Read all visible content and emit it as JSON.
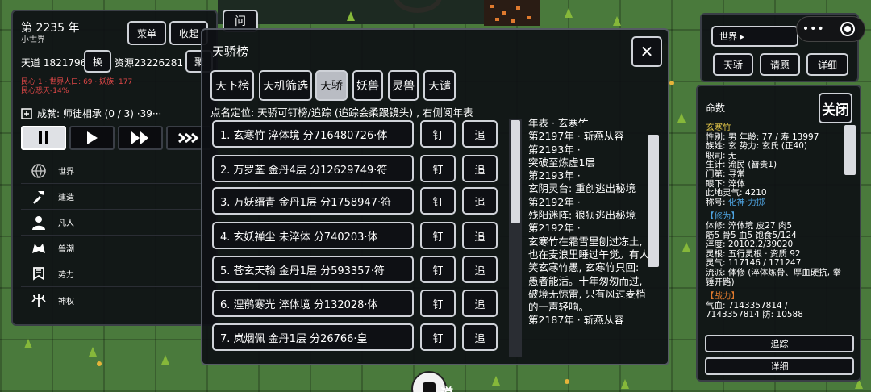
{
  "left": {
    "year": "第 2235 年",
    "world_name": "小世界",
    "menu": "菜单",
    "collapse": "收起",
    "tiandao": "天道 1821796",
    "swap": "换",
    "resource": "资源23226281",
    "extra": "聚",
    "line1": "民心 1 · 世界人口: 69 · 妖族: 177",
    "line2": "民心恐天-14%",
    "achievement": "成就: 师徒相承 (0 / 3) ·39···",
    "nav": [
      {
        "label": "世界",
        "icon": "globe-icon"
      },
      {
        "label": "建造",
        "icon": "hammer-icon"
      },
      {
        "label": "凡人",
        "icon": "person-icon"
      },
      {
        "label": "兽潮",
        "icon": "wolf-icon"
      },
      {
        "label": "势力",
        "icon": "banner-icon"
      },
      {
        "label": "神权",
        "icon": "trident-icon"
      }
    ]
  },
  "top_center_button": "问",
  "dialog": {
    "title": "天骄榜",
    "close": "✕",
    "tabs": [
      "天下榜",
      "天机筛选",
      "天骄",
      "妖兽",
      "灵兽",
      "天谴"
    ],
    "active_tab": 2,
    "hint": "点名定位: 天骄可钉榜/追踪 (追踪会柔跟镜头) , 右侧阅年表",
    "pin": "钉",
    "track": "追",
    "rows": [
      "1. 玄寒竹  淬体境  分716480726·体",
      "2. 万罗荃  金丹4层  分12629749·符",
      "3. 万妖缙青  金丹1层  分1758947·符",
      "4. 玄妖禅尘  未淬体  分740203·体",
      "5. 苍玄天翰  金丹1层  分593357·符",
      "6. 浬鹡寒光  淬体境  分132028·体",
      "7. 岚烟佩  金丹1层  分26766·皇"
    ],
    "annals": "年表 · 玄寒竹\n第2197年 · 斩燕从容\n第2193年 ·\n突破至炼虚1层\n第2193年 ·\n玄阴灵台: 重创逃出秘境\n第2192年 ·\n残阳迷阵: 狼狈逃出秘境\n第2192年 ·\n玄寒竹在霜雪里刨过冻土, 也在麦浪里睡过午觉。有人笑玄寒竹愚, 玄寒竹只回: 愚者能活。十年匆匆而过, 破境无惊雷, 只有风过麦梢的一声轻响。\n第2187年 · 斩燕从容"
  },
  "right_top": {
    "world_select": "世界 ▸",
    "buttons": [
      "天骄",
      "请愿",
      "详细"
    ],
    "capsule_dots": "•••"
  },
  "right_detail": {
    "title": "命数",
    "close": "关闭",
    "name": "玄寒竹",
    "lines": [
      "性别: 男  年龄: 77 / 寿 13997",
      "族姓: 玄  势力: 玄氏 (正40)",
      "职司: 无",
      "生计: 流民 (簪责1)",
      "门第: 寻常",
      "眼下: 淬体",
      "此地灵气: 4210"
    ],
    "title_label": "称号: ",
    "title_value": "化神·力掷",
    "cultivation_header": "【修为】",
    "cultivation": [
      "体修: 淬体境  皮27  肉5",
      "筋5  骨5  血5  饱食5/124",
      "淬度: 20102.2/39020",
      "灵根: 五行灵根 · 资质 92",
      "灵气: 117146 / 171247",
      "流派: 体修 (淬体炼骨、厚血硬抗, 拳锤开路)"
    ],
    "combat_header": "【战力】",
    "combat": [
      "气血: 7143357814 /",
      "7143357814  防: 10588"
    ],
    "track_btn": "追踪",
    "detail_btn": "详细"
  },
  "bottom_char": "道"
}
